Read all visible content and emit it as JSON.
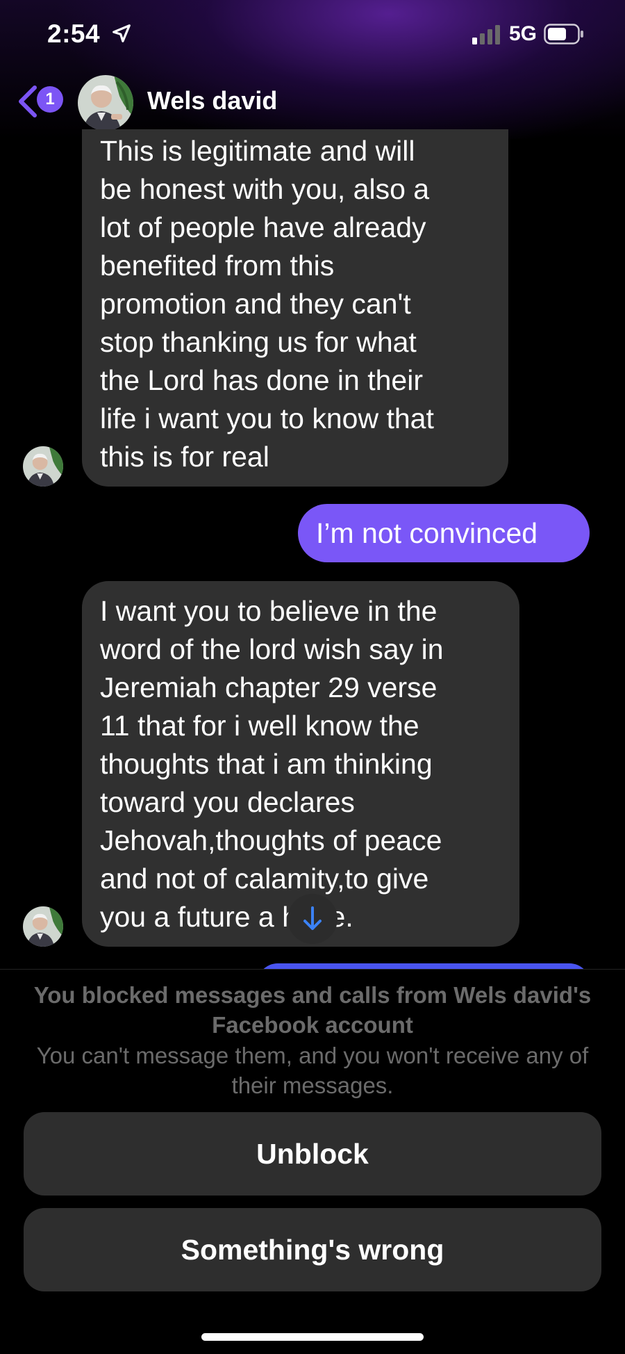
{
  "status_bar": {
    "time": "2:54",
    "network": "5G",
    "icons": [
      "location-arrow-icon",
      "signal-icon",
      "battery-icon"
    ]
  },
  "header": {
    "back_badge": "1",
    "contact_name": "Wels david",
    "icons": [
      "back-chevron-icon"
    ]
  },
  "messages": [
    {
      "direction": "incoming",
      "lines": [
        "This is legitimate and will",
        "be honest with you, also a",
        "lot of people have already",
        "benefited from this",
        "promotion and they can't",
        "stop thanking us for what",
        "the Lord has done in their",
        "life i want you to know that",
        "this is for real"
      ]
    },
    {
      "direction": "outgoing",
      "text": "I’m not convinced"
    },
    {
      "direction": "incoming",
      "lines": [
        "I want  you to believe in the",
        "word of the lord wish say in",
        "Jeremiah chapter 29 verse",
        "11 that for i well know the",
        "thoughts that i am thinking",
        "toward you declares",
        "Jehovah,thoughts of peace",
        "and not of calamity,to give",
        "you a future a   hope."
      ]
    }
  ],
  "blocked": {
    "title": "You blocked messages and calls from Wels david's Facebook account",
    "description": "You can't message them, and you won't receive any of their messages.",
    "unblock_label": "Unblock",
    "something_wrong_label": "Something's wrong"
  },
  "colors": {
    "outgoing_bubble": "#7a57f7",
    "incoming_bubble": "#303030",
    "accent": "#7c55f5",
    "scroll_arrow": "#3b82f6"
  }
}
